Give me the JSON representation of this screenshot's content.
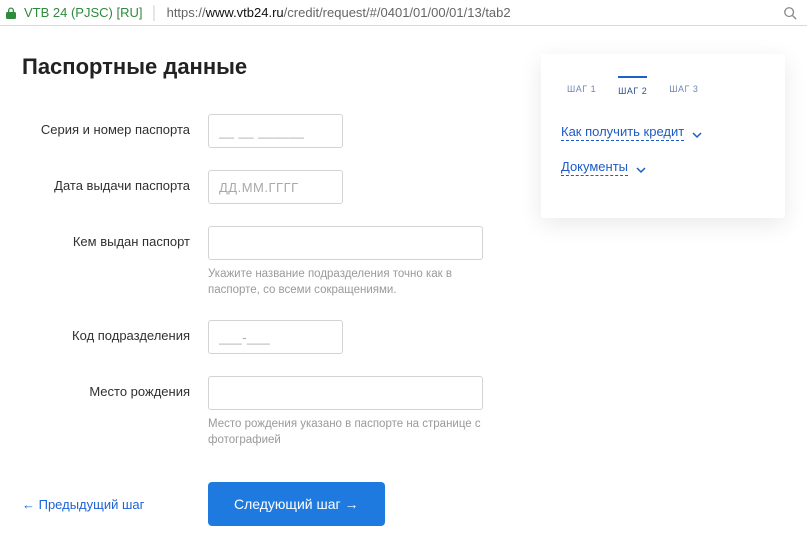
{
  "browser": {
    "cert": "VTB 24 (PJSC) [RU]",
    "url_prefix": "https://",
    "url_host": "www.vtb24.ru",
    "url_path": "/credit/request/#/0401/01/00/01/13/tab2"
  },
  "page": {
    "title": "Паспортные данные"
  },
  "form": {
    "passport_series": {
      "label": "Серия и номер паспорта",
      "placeholder": "__ __ ______"
    },
    "issue_date": {
      "label": "Дата выдачи паспорта",
      "placeholder": "ДД.ММ.ГГГГ"
    },
    "issued_by": {
      "label": "Кем выдан паспорт",
      "hint": "Укажите название подразделения точно как в паспорте, со всеми сокращениями."
    },
    "dept_code": {
      "label": "Код подразделения",
      "placeholder": "___-___"
    },
    "birthplace": {
      "label": "Место рождения",
      "hint": "Место рождения указано в паспорте на странице с фотографией"
    }
  },
  "actions": {
    "prev": "← Предыдущий шаг",
    "next": "Следующий шаг →"
  },
  "sidebar": {
    "steps": [
      "ШАГ 1",
      "ШАГ 2",
      "ШАГ 3"
    ],
    "links": {
      "how": "Как получить кредит",
      "docs": "Документы"
    }
  }
}
